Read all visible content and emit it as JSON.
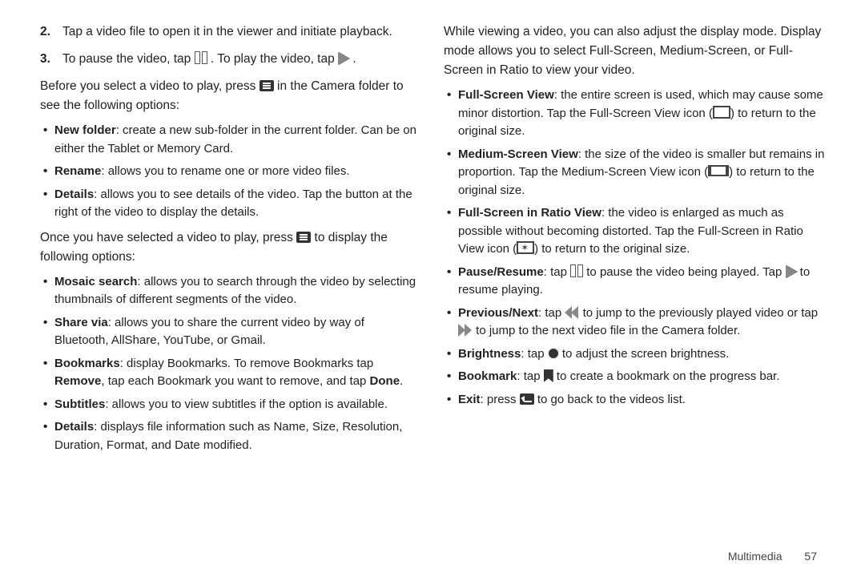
{
  "left": {
    "step2_num": "2.",
    "step2": "Tap a video file to open it in the viewer and initiate playback.",
    "step3_num": "3.",
    "step3_a": "To pause the video, tap ",
    "step3_b": ". To play the video, tap ",
    "step3_c": ".",
    "before_a": "Before you select a video to play, press ",
    "before_b": " in the Camera folder to see the following options:",
    "pre_bullets": [
      {
        "bold": "New folder",
        "rest": ": create a new sub-folder in the current folder. Can be on either the Tablet or Memory Card."
      },
      {
        "bold": "Rename",
        "rest": ": allows you to rename one or more video files."
      },
      {
        "bold": "Details",
        "rest": ": allows you to see details of the video. Tap the button at the right of the video to display the details."
      }
    ],
    "once_a": "Once you have selected a video to play, press ",
    "once_b": " to display the following options:",
    "post_bullets": [
      {
        "bold": "Mosaic search",
        "rest": ": allows you to search through the video by selecting thumbnails of different segments of the video."
      },
      {
        "bold": "Share via",
        "rest": ": allows you to share the current video by way of Bluetooth, AllShare, YouTube, or Gmail."
      },
      {
        "bold": "Bookmarks",
        "rest": ": display Bookmarks. To remove Bookmarks tap ",
        "bold2": "Remove",
        "rest2": ", tap each Bookmark you want to remove, and tap ",
        "bold3": "Done",
        "rest3": "."
      },
      {
        "bold": "Subtitles",
        "rest": ": allows you to view subtitles if the option is available."
      },
      {
        "bold": "Details",
        "rest": ": displays file information such as Name, Size, Resolution, Duration, Format, and Date modified."
      }
    ]
  },
  "right": {
    "intro": "While viewing a video, you can also adjust the display mode. Display mode allows you to select Full-Screen, Medium-Screen, or Full-Screen in Ratio to view your video.",
    "bullets": {
      "full": {
        "bold": "Full-Screen View",
        "a": ": the entire screen is used, which may cause some minor distortion. Tap the Full-Screen View icon (",
        "b": ") to return to the original size."
      },
      "med": {
        "bold": "Medium-Screen View",
        "a": ": the size of the video is smaller but remains in proportion. Tap the Medium-Screen View icon (",
        "b": ") to return to the original size."
      },
      "ratio": {
        "bold": "Full-Screen in Ratio View",
        "a": ": the video is enlarged as much as possible without becoming distorted. Tap the Full-Screen in Ratio View icon (",
        "b": ") to return to the original size."
      },
      "pause": {
        "bold": "Pause/Resume",
        "a": ": tap ",
        "b": " to pause the video being played. Tap ",
        "c": " to resume playing."
      },
      "prev": {
        "bold": "Previous/Next",
        "a": ": tap ",
        "b": " to jump to the previously played video or tap ",
        "c": " to jump to the next video file in the Camera folder."
      },
      "bright": {
        "bold": "Brightness",
        "a": ": tap ",
        "b": " to adjust the screen brightness."
      },
      "bkmk": {
        "bold": "Bookmark",
        "a": ": tap ",
        "b": " to create a bookmark on the progress bar."
      },
      "exit": {
        "bold": "Exit",
        "a": ": press ",
        "b": " to go back to the videos list."
      }
    }
  },
  "footer": {
    "section": "Multimedia",
    "page": "57"
  }
}
